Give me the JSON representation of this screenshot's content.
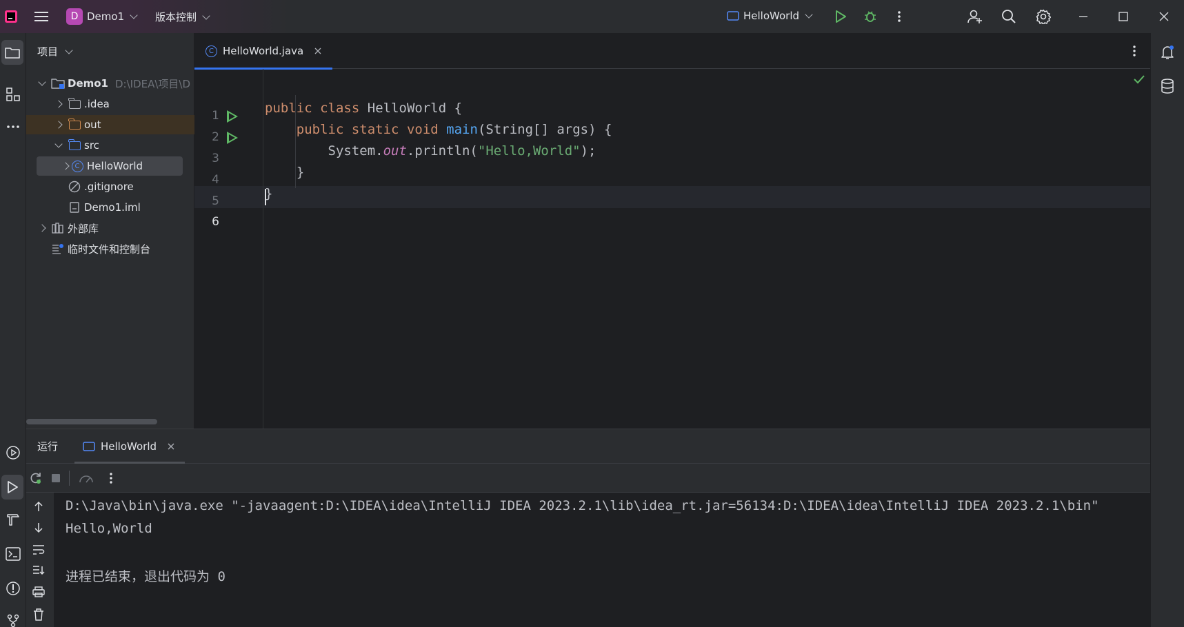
{
  "titlebar": {
    "project_badge": "D",
    "project_name": "Demo1",
    "vcs_label": "版本控制",
    "run_config": "HelloWorld",
    "icons": [
      "app-logo-icon",
      "hamburger-menu-icon",
      "run-icon",
      "debug-icon",
      "more-icon",
      "add-user-icon",
      "search-icon",
      "settings-icon",
      "minimize-icon",
      "maximize-icon",
      "close-icon"
    ]
  },
  "left_strip": {
    "icons": [
      "project-folder-icon",
      "structure-icon",
      "more-tools-icon",
      "services-icon",
      "run-tool-icon",
      "build-icon",
      "terminal-icon",
      "problems-icon",
      "git-icon"
    ]
  },
  "project_panel": {
    "title": "项目",
    "tree": [
      {
        "label": "Demo1",
        "path": "D:\\IDEA\\项目\\D",
        "icon": "module-icon"
      },
      {
        "label": ".idea",
        "icon": "folder-icon"
      },
      {
        "label": "out",
        "icon": "folder-orange-icon"
      },
      {
        "label": "src",
        "icon": "folder-blue-icon"
      },
      {
        "label": "HelloWorld",
        "icon": "class-icon",
        "class_letter": "C"
      },
      {
        "label": ".gitignore",
        "icon": "ignore-file-icon"
      },
      {
        "label": "Demo1.iml",
        "icon": "iml-file-icon"
      },
      {
        "label": "外部库",
        "icon": "library-icon"
      },
      {
        "label": "临时文件和控制台",
        "icon": "scratch-icon"
      }
    ]
  },
  "editor": {
    "tab_label": "HelloWorld.java",
    "tab_class_letter": "C",
    "line_numbers": [
      "1",
      "2",
      "3",
      "4",
      "5",
      "6"
    ],
    "code": {
      "l1": {
        "kw1": "public",
        "kw2": "class",
        "name": "HelloWorld",
        "brace": "{"
      },
      "l2": {
        "kw1": "public",
        "kw2": "static",
        "kw3": "void",
        "fn": "main",
        "args": "(String[] args) {"
      },
      "l3": {
        "obj": "System.",
        "field": "out",
        "call": ".println(",
        "str": "\"Hello,World\"",
        "end": ");"
      },
      "l4": "}",
      "l5": "}"
    }
  },
  "run_panel": {
    "title": "运行",
    "tab_label": "HelloWorld",
    "console_lines": [
      "D:\\Java\\bin\\java.exe \"-javaagent:D:\\IDEA\\idea\\IntelliJ IDEA 2023.2.1\\lib\\idea_rt.jar=56134:D:\\IDEA\\idea\\IntelliJ IDEA 2023.2.1\\bin\"",
      "Hello,World",
      "",
      "进程已结束，退出代码为 0"
    ]
  },
  "colors": {
    "accent": "#3574f0",
    "run_green": "#5fb865",
    "keyword": "#cf8e6d",
    "string": "#6aab73",
    "function": "#56a8f5",
    "field": "#c77dbb",
    "project_badge": "#b649b3"
  }
}
